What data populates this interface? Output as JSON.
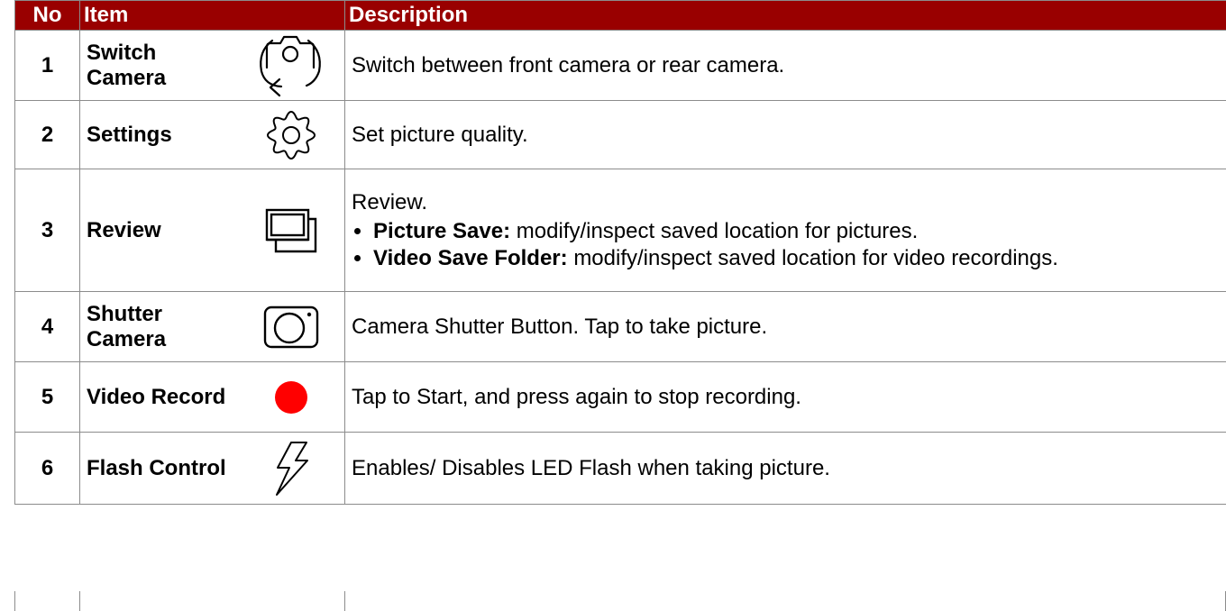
{
  "header": {
    "no": "No",
    "item": "Item",
    "description": "Description"
  },
  "rows": [
    {
      "no": "1",
      "item": "Switch Camera",
      "icon": "switch-camera-icon",
      "description": "Switch between front camera or rear camera."
    },
    {
      "no": "2",
      "item": "Settings",
      "icon": "gear-icon",
      "description": "Set picture quality."
    },
    {
      "no": "3",
      "item": "Review",
      "icon": "gallery-icon",
      "description": "Review.",
      "bullets": [
        {
          "term": "Picture Save:",
          "text": "modify/inspect saved location for pictures."
        },
        {
          "term": "Video Save Folder:",
          "text": "modify/inspect saved location for video recordings."
        }
      ]
    },
    {
      "no": "4",
      "item": "Shutter Camera",
      "icon": "shutter-camera-icon",
      "description": "Camera Shutter Button. Tap to take picture."
    },
    {
      "no": "5",
      "item": "Video Record",
      "icon": "record-dot-icon",
      "description": "Tap to Start, and press again to stop recording."
    },
    {
      "no": "6",
      "item": "Flash Control",
      "icon": "flash-icon",
      "description": "Enables/ Disables LED Flash when taking picture."
    }
  ],
  "colors": {
    "header_bg": "#990000",
    "header_text": "#ffffff",
    "record_dot": "#ff0000",
    "grid": "#8c8c8c"
  }
}
